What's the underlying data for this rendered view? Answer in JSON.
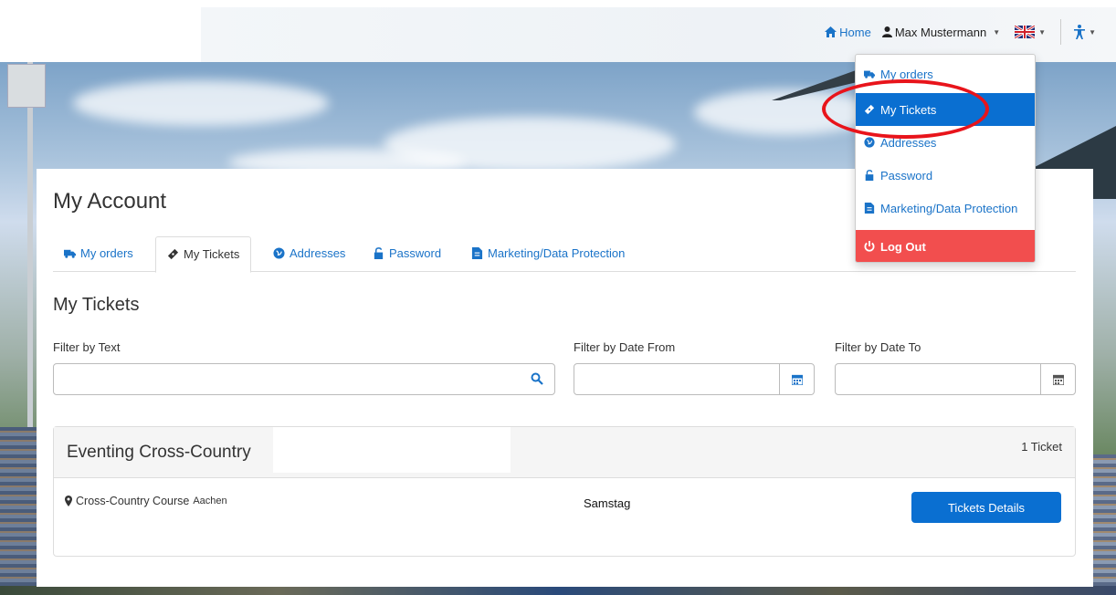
{
  "nav": {
    "home_label": "Home",
    "user_name": "Max Mustermann"
  },
  "account": {
    "page_title": "My Account",
    "tabs": [
      {
        "label": "My orders",
        "icon": "truck-icon"
      },
      {
        "label": "My Tickets",
        "icon": "ticket-icon",
        "active": true
      },
      {
        "label": "Addresses",
        "icon": "globe-icon"
      },
      {
        "label": "Password",
        "icon": "lock-icon"
      },
      {
        "label": "Marketing/Data Protection",
        "icon": "document-icon"
      }
    ],
    "section_title": "My Tickets"
  },
  "filters": {
    "text_label": "Filter by Text",
    "date_from_label": "Filter by Date From",
    "date_to_label": "Filter by Date To",
    "text_value": "",
    "date_from_value": "",
    "date_to_value": ""
  },
  "event": {
    "title": "Eventing Cross-Country",
    "ticket_count": "1 Ticket",
    "venue": "Cross-Country Course",
    "city": "Aachen",
    "day": "Samstag",
    "details_button": "Tickets Details"
  },
  "dropdown": {
    "items": [
      {
        "label": "My orders",
        "icon": "truck-icon"
      },
      {
        "label": "My Tickets",
        "icon": "ticket-icon",
        "active": true
      },
      {
        "label": "Addresses",
        "icon": "globe-icon"
      },
      {
        "label": "Password",
        "icon": "lock-icon"
      },
      {
        "label": "Marketing/Data Protection",
        "icon": "document-icon"
      },
      {
        "label": "Log Out",
        "icon": "power-icon"
      }
    ]
  },
  "colors": {
    "link": "#1a73c8",
    "primary": "#0a6fd1",
    "logout": "#f24e4e",
    "highlight": "#e8141b"
  }
}
